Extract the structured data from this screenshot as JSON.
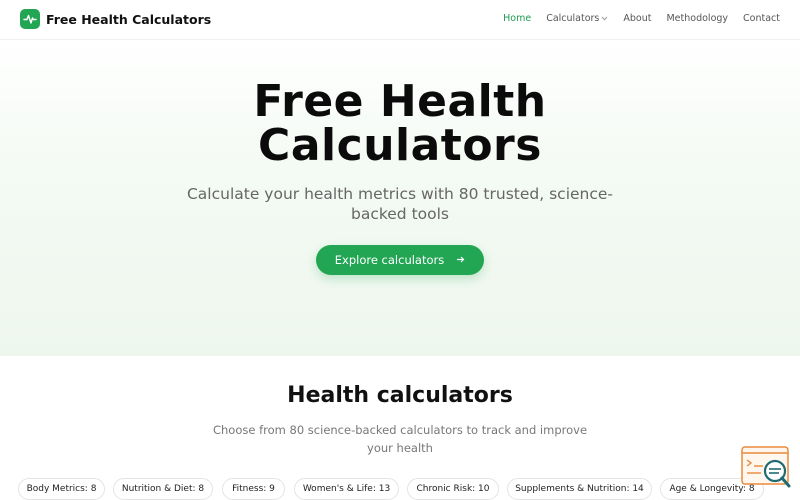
{
  "header": {
    "brand_name": "Free Health Calculators",
    "nav": [
      {
        "label": "Home",
        "active": true
      },
      {
        "label": "Calculators",
        "active": false,
        "has_dropdown": true
      },
      {
        "label": "About",
        "active": false
      },
      {
        "label": "Methodology",
        "active": false
      },
      {
        "label": "Contact",
        "active": false
      }
    ]
  },
  "hero": {
    "title_line1": "Free Health",
    "title_line2": "Calculators",
    "subtitle_line1": "Calculate your health metrics with 80 trusted, science-",
    "subtitle_line2": "backed tools",
    "cta_label": "Explore calculators"
  },
  "section": {
    "title": "Health calculators",
    "subtitle_line1": "Choose from 80 science-backed calculators to track and improve",
    "subtitle_line2": "your health"
  },
  "categories": [
    "Body Metrics: 8",
    "Nutrition & Diet: 8",
    "Fitness: 9",
    "Women's & Life: 13",
    "Chronic Risk: 10",
    "Supplements & Nutrition: 14",
    "Age & Longevity: 8"
  ],
  "colors": {
    "accent": "#22a653",
    "nav_active": "#1e9b4f",
    "widget_orange": "#e88a3c",
    "widget_teal": "#1f6b73"
  },
  "icons": {
    "brand": "heart-pulse-icon",
    "cta": "arrow-right-icon",
    "dropdown": "chevron-down-icon",
    "widget": "search-document-icon"
  }
}
